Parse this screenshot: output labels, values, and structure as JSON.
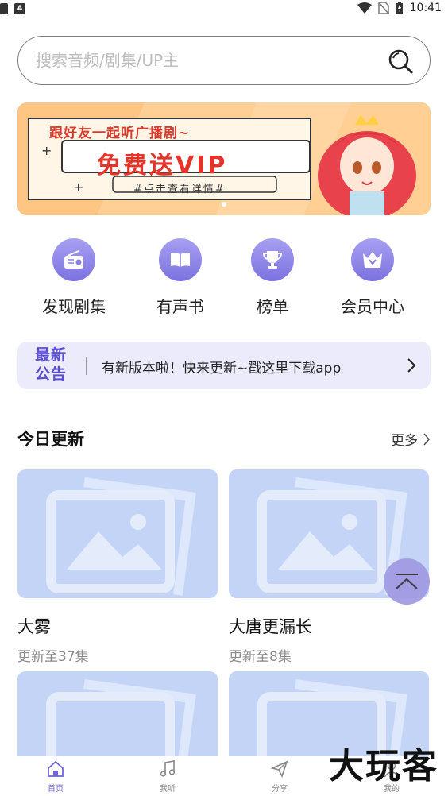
{
  "status_bar": {
    "time": "10:41",
    "notif_a": "A"
  },
  "search": {
    "placeholder": "搜索音频/剧集/UP主"
  },
  "banner": {
    "line1": "跟好友一起听广播剧~",
    "line2": "免费送VIP",
    "line3": "#点击查看详情#"
  },
  "quicknav": [
    {
      "label": "发现剧集",
      "icon": "radio-icon"
    },
    {
      "label": "有声书",
      "icon": "book-icon"
    },
    {
      "label": "榜单",
      "icon": "trophy-icon"
    },
    {
      "label": "会员中心",
      "icon": "crown-icon"
    }
  ],
  "notice": {
    "tag_top": "最新",
    "tag_bottom": "公告",
    "text": "有新版本啦！快来更新~戳这里下载app"
  },
  "section": {
    "title": "今日更新",
    "more": "更多"
  },
  "cards": [
    {
      "title": "大雾",
      "subtitle": "更新至37集"
    },
    {
      "title": "大唐更漏长",
      "subtitle": "更新至8集"
    },
    {
      "title": "",
      "subtitle": ""
    },
    {
      "title": "",
      "subtitle": ""
    }
  ],
  "bottom_nav": [
    {
      "label": "首页",
      "icon": "home-icon",
      "active": true
    },
    {
      "label": "我听",
      "icon": "music-note-icon",
      "active": false
    },
    {
      "label": "分享",
      "icon": "send-icon",
      "active": false
    },
    {
      "label": "我的",
      "icon": "user-icon",
      "active": false
    }
  ],
  "watermark": "大玩客",
  "colors": {
    "accent": "#7c72df",
    "notice_bg": "#ecebfb",
    "placeholder_thumb": "#c3d4f7",
    "banner_bg": "#ffc98a"
  }
}
